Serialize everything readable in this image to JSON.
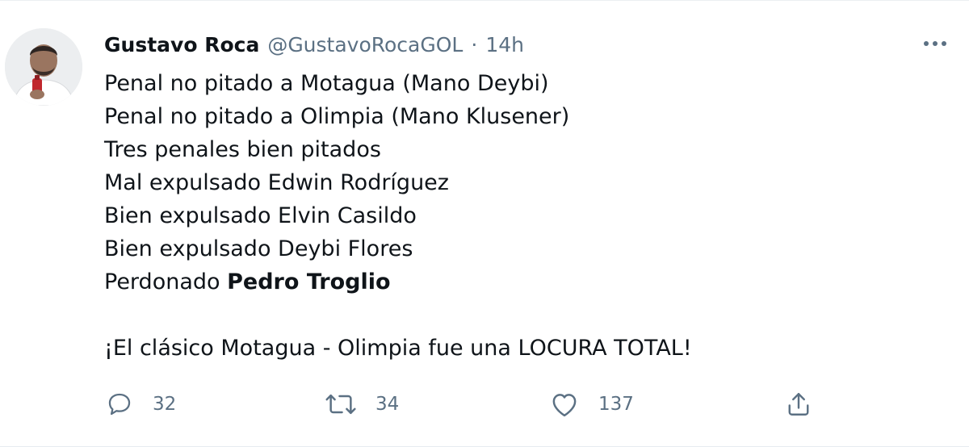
{
  "tweet": {
    "author_name": "Gustavo Roca",
    "author_handle": "@GustavoRocaGOL",
    "separator": "·",
    "time": "14h",
    "lines": [
      "Penal no pitado a Motagua (Mano Deybi)",
      "Penal no pitado a Olimpia (Mano Klusener)",
      "Tres penales bien pitados",
      "Mal expulsado Edwin Rodríguez",
      "Bien expulsado Elvin Casildo",
      "Bien expulsado Deybi Flores"
    ],
    "last_line_prefix": "Perdonado",
    "last_line_bold": "Pedro Troglio",
    "closing": "¡El clásico Motagua - Olimpia fue una LOCURA TOTAL!"
  },
  "actions": {
    "reply_count": "32",
    "retweet_count": "34",
    "like_count": "137"
  },
  "icons": {
    "more": "more-horizontal-icon",
    "reply": "reply-icon",
    "retweet": "retweet-icon",
    "like": "heart-icon",
    "share": "share-icon"
  },
  "colors": {
    "text": "#0f1419",
    "secondary": "#5b7083"
  }
}
